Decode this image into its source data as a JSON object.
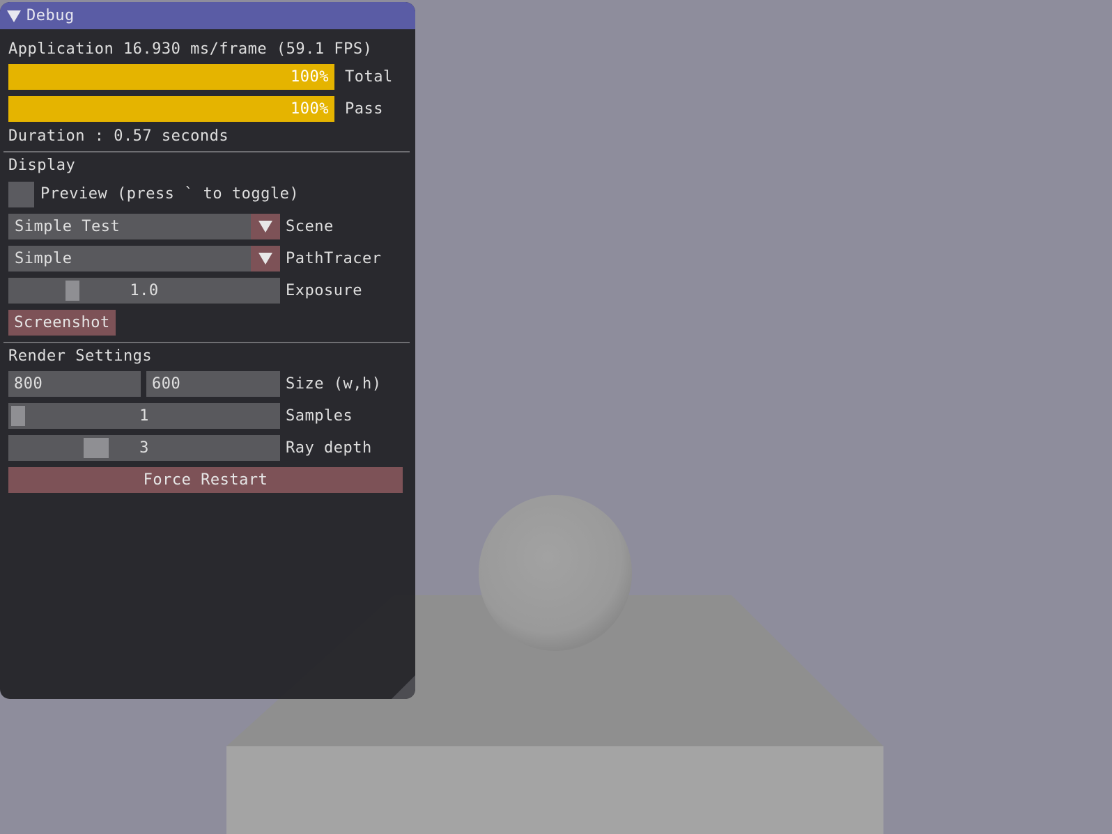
{
  "window": {
    "title": "Debug"
  },
  "stats": {
    "application": "Application 16.930 ms/frame (59.1 FPS)",
    "duration": "Duration : 0.57 seconds"
  },
  "progress": [
    {
      "label": "Total",
      "value": 1.0,
      "text": "100%"
    },
    {
      "label": "Pass",
      "value": 1.0,
      "text": "100%"
    }
  ],
  "display": {
    "header": "Display",
    "preview_label": "Preview (press ` to toggle)",
    "preview_checked": false,
    "scene": {
      "value": "Simple Test",
      "label": "Scene"
    },
    "pathtracer": {
      "value": "Simple",
      "label": "PathTracer"
    },
    "exposure": {
      "value": "1.0",
      "label": "Exposure"
    },
    "screenshot_label": "Screenshot"
  },
  "render": {
    "header": "Render Settings",
    "width": "800",
    "height": "600",
    "size_label": "Size (w,h)",
    "samples": {
      "value": "1",
      "label": "Samples"
    },
    "ray_depth": {
      "value": "3",
      "label": "Ray depth"
    },
    "restart_label": "Force Restart"
  },
  "colors": {
    "titlebar": "#5a5ca5",
    "progress_fill": "#e5b400",
    "button": "#7d5257",
    "background": "#8e8d9c"
  }
}
